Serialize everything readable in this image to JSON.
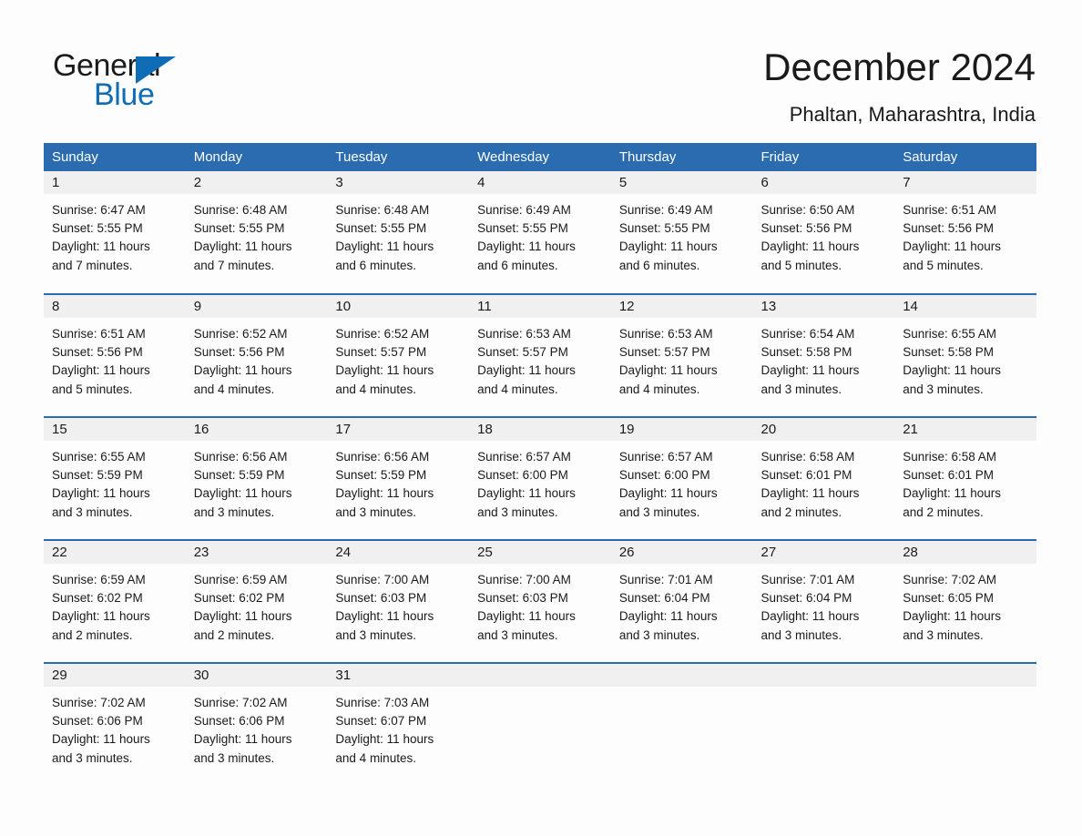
{
  "brand": {
    "name_part1": "General",
    "name_part2": "Blue",
    "triangle_color": "#0f6cb5"
  },
  "header": {
    "title": "December 2024",
    "location": "Phaltan, Maharashtra, India"
  },
  "colors": {
    "header_blue": "#2b6cb0",
    "daynum_strip": "#f0f0f0",
    "page_background": "#fdfdfd",
    "text": "#1a1a1a"
  },
  "calendar": {
    "weekday_headers": [
      "Sunday",
      "Monday",
      "Tuesday",
      "Wednesday",
      "Thursday",
      "Friday",
      "Saturday"
    ],
    "weeks": [
      [
        {
          "day": "1",
          "sunrise": "Sunrise: 6:47 AM",
          "sunset": "Sunset: 5:55 PM",
          "daylight_line1": "Daylight: 11 hours",
          "daylight_line2": "and 7 minutes."
        },
        {
          "day": "2",
          "sunrise": "Sunrise: 6:48 AM",
          "sunset": "Sunset: 5:55 PM",
          "daylight_line1": "Daylight: 11 hours",
          "daylight_line2": "and 7 minutes."
        },
        {
          "day": "3",
          "sunrise": "Sunrise: 6:48 AM",
          "sunset": "Sunset: 5:55 PM",
          "daylight_line1": "Daylight: 11 hours",
          "daylight_line2": "and 6 minutes."
        },
        {
          "day": "4",
          "sunrise": "Sunrise: 6:49 AM",
          "sunset": "Sunset: 5:55 PM",
          "daylight_line1": "Daylight: 11 hours",
          "daylight_line2": "and 6 minutes."
        },
        {
          "day": "5",
          "sunrise": "Sunrise: 6:49 AM",
          "sunset": "Sunset: 5:55 PM",
          "daylight_line1": "Daylight: 11 hours",
          "daylight_line2": "and 6 minutes."
        },
        {
          "day": "6",
          "sunrise": "Sunrise: 6:50 AM",
          "sunset": "Sunset: 5:56 PM",
          "daylight_line1": "Daylight: 11 hours",
          "daylight_line2": "and 5 minutes."
        },
        {
          "day": "7",
          "sunrise": "Sunrise: 6:51 AM",
          "sunset": "Sunset: 5:56 PM",
          "daylight_line1": "Daylight: 11 hours",
          "daylight_line2": "and 5 minutes."
        }
      ],
      [
        {
          "day": "8",
          "sunrise": "Sunrise: 6:51 AM",
          "sunset": "Sunset: 5:56 PM",
          "daylight_line1": "Daylight: 11 hours",
          "daylight_line2": "and 5 minutes."
        },
        {
          "day": "9",
          "sunrise": "Sunrise: 6:52 AM",
          "sunset": "Sunset: 5:56 PM",
          "daylight_line1": "Daylight: 11 hours",
          "daylight_line2": "and 4 minutes."
        },
        {
          "day": "10",
          "sunrise": "Sunrise: 6:52 AM",
          "sunset": "Sunset: 5:57 PM",
          "daylight_line1": "Daylight: 11 hours",
          "daylight_line2": "and 4 minutes."
        },
        {
          "day": "11",
          "sunrise": "Sunrise: 6:53 AM",
          "sunset": "Sunset: 5:57 PM",
          "daylight_line1": "Daylight: 11 hours",
          "daylight_line2": "and 4 minutes."
        },
        {
          "day": "12",
          "sunrise": "Sunrise: 6:53 AM",
          "sunset": "Sunset: 5:57 PM",
          "daylight_line1": "Daylight: 11 hours",
          "daylight_line2": "and 4 minutes."
        },
        {
          "day": "13",
          "sunrise": "Sunrise: 6:54 AM",
          "sunset": "Sunset: 5:58 PM",
          "daylight_line1": "Daylight: 11 hours",
          "daylight_line2": "and 3 minutes."
        },
        {
          "day": "14",
          "sunrise": "Sunrise: 6:55 AM",
          "sunset": "Sunset: 5:58 PM",
          "daylight_line1": "Daylight: 11 hours",
          "daylight_line2": "and 3 minutes."
        }
      ],
      [
        {
          "day": "15",
          "sunrise": "Sunrise: 6:55 AM",
          "sunset": "Sunset: 5:59 PM",
          "daylight_line1": "Daylight: 11 hours",
          "daylight_line2": "and 3 minutes."
        },
        {
          "day": "16",
          "sunrise": "Sunrise: 6:56 AM",
          "sunset": "Sunset: 5:59 PM",
          "daylight_line1": "Daylight: 11 hours",
          "daylight_line2": "and 3 minutes."
        },
        {
          "day": "17",
          "sunrise": "Sunrise: 6:56 AM",
          "sunset": "Sunset: 5:59 PM",
          "daylight_line1": "Daylight: 11 hours",
          "daylight_line2": "and 3 minutes."
        },
        {
          "day": "18",
          "sunrise": "Sunrise: 6:57 AM",
          "sunset": "Sunset: 6:00 PM",
          "daylight_line1": "Daylight: 11 hours",
          "daylight_line2": "and 3 minutes."
        },
        {
          "day": "19",
          "sunrise": "Sunrise: 6:57 AM",
          "sunset": "Sunset: 6:00 PM",
          "daylight_line1": "Daylight: 11 hours",
          "daylight_line2": "and 3 minutes."
        },
        {
          "day": "20",
          "sunrise": "Sunrise: 6:58 AM",
          "sunset": "Sunset: 6:01 PM",
          "daylight_line1": "Daylight: 11 hours",
          "daylight_line2": "and 2 minutes."
        },
        {
          "day": "21",
          "sunrise": "Sunrise: 6:58 AM",
          "sunset": "Sunset: 6:01 PM",
          "daylight_line1": "Daylight: 11 hours",
          "daylight_line2": "and 2 minutes."
        }
      ],
      [
        {
          "day": "22",
          "sunrise": "Sunrise: 6:59 AM",
          "sunset": "Sunset: 6:02 PM",
          "daylight_line1": "Daylight: 11 hours",
          "daylight_line2": "and 2 minutes."
        },
        {
          "day": "23",
          "sunrise": "Sunrise: 6:59 AM",
          "sunset": "Sunset: 6:02 PM",
          "daylight_line1": "Daylight: 11 hours",
          "daylight_line2": "and 2 minutes."
        },
        {
          "day": "24",
          "sunrise": "Sunrise: 7:00 AM",
          "sunset": "Sunset: 6:03 PM",
          "daylight_line1": "Daylight: 11 hours",
          "daylight_line2": "and 3 minutes."
        },
        {
          "day": "25",
          "sunrise": "Sunrise: 7:00 AM",
          "sunset": "Sunset: 6:03 PM",
          "daylight_line1": "Daylight: 11 hours",
          "daylight_line2": "and 3 minutes."
        },
        {
          "day": "26",
          "sunrise": "Sunrise: 7:01 AM",
          "sunset": "Sunset: 6:04 PM",
          "daylight_line1": "Daylight: 11 hours",
          "daylight_line2": "and 3 minutes."
        },
        {
          "day": "27",
          "sunrise": "Sunrise: 7:01 AM",
          "sunset": "Sunset: 6:04 PM",
          "daylight_line1": "Daylight: 11 hours",
          "daylight_line2": "and 3 minutes."
        },
        {
          "day": "28",
          "sunrise": "Sunrise: 7:02 AM",
          "sunset": "Sunset: 6:05 PM",
          "daylight_line1": "Daylight: 11 hours",
          "daylight_line2": "and 3 minutes."
        }
      ],
      [
        {
          "day": "29",
          "sunrise": "Sunrise: 7:02 AM",
          "sunset": "Sunset: 6:06 PM",
          "daylight_line1": "Daylight: 11 hours",
          "daylight_line2": "and 3 minutes."
        },
        {
          "day": "30",
          "sunrise": "Sunrise: 7:02 AM",
          "sunset": "Sunset: 6:06 PM",
          "daylight_line1": "Daylight: 11 hours",
          "daylight_line2": "and 3 minutes."
        },
        {
          "day": "31",
          "sunrise": "Sunrise: 7:03 AM",
          "sunset": "Sunset: 6:07 PM",
          "daylight_line1": "Daylight: 11 hours",
          "daylight_line2": "and 4 minutes."
        },
        {
          "day": "",
          "sunrise": "",
          "sunset": "",
          "daylight_line1": "",
          "daylight_line2": ""
        },
        {
          "day": "",
          "sunrise": "",
          "sunset": "",
          "daylight_line1": "",
          "daylight_line2": ""
        },
        {
          "day": "",
          "sunrise": "",
          "sunset": "",
          "daylight_line1": "",
          "daylight_line2": ""
        },
        {
          "day": "",
          "sunrise": "",
          "sunset": "",
          "daylight_line1": "",
          "daylight_line2": ""
        }
      ]
    ]
  }
}
